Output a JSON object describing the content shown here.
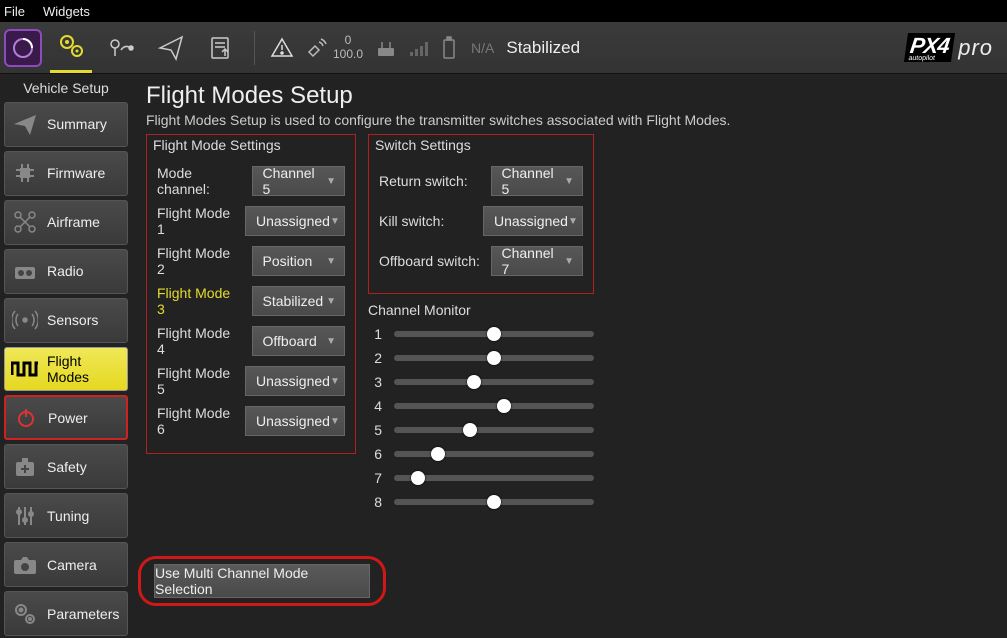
{
  "menubar": {
    "file": "File",
    "widgets": "Widgets"
  },
  "toolbar": {
    "counts_top": "0",
    "counts_bottom": "100.0",
    "na": "N/A",
    "mode": "Stabilized",
    "logo_main": "PX4",
    "logo_sub": "autopilot",
    "logo_pro": "pro"
  },
  "sidebar": {
    "title": "Vehicle Setup",
    "items": [
      {
        "label": "Summary"
      },
      {
        "label": "Firmware"
      },
      {
        "label": "Airframe"
      },
      {
        "label": "Radio"
      },
      {
        "label": "Sensors"
      },
      {
        "label": "Flight Modes"
      },
      {
        "label": "Power"
      },
      {
        "label": "Safety"
      },
      {
        "label": "Tuning"
      },
      {
        "label": "Camera"
      },
      {
        "label": "Parameters"
      }
    ]
  },
  "page": {
    "title": "Flight Modes Setup",
    "desc": "Flight Modes Setup is used to configure the transmitter switches associated with Flight Modes."
  },
  "flight_mode_settings": {
    "title": "Flight Mode Settings",
    "mode_channel_label": "Mode channel:",
    "mode_channel_value": "Channel 5",
    "rows": [
      {
        "label": "Flight Mode 1",
        "value": "Unassigned",
        "active": false
      },
      {
        "label": "Flight Mode 2",
        "value": "Position",
        "active": false
      },
      {
        "label": "Flight Mode 3",
        "value": "Stabilized",
        "active": true
      },
      {
        "label": "Flight Mode 4",
        "value": "Offboard",
        "active": false
      },
      {
        "label": "Flight Mode 5",
        "value": "Unassigned",
        "active": false
      },
      {
        "label": "Flight Mode 6",
        "value": "Unassigned",
        "active": false
      }
    ]
  },
  "switch_settings": {
    "title": "Switch Settings",
    "rows": [
      {
        "label": "Return switch:",
        "value": "Channel 5"
      },
      {
        "label": "Kill switch:",
        "value": "Unassigned"
      },
      {
        "label": "Offboard switch:",
        "value": "Channel 7"
      }
    ]
  },
  "channel_monitor": {
    "title": "Channel Monitor",
    "channels": [
      {
        "n": "1",
        "pos": 0.5
      },
      {
        "n": "2",
        "pos": 0.5
      },
      {
        "n": "3",
        "pos": 0.4
      },
      {
        "n": "4",
        "pos": 0.55
      },
      {
        "n": "5",
        "pos": 0.38
      },
      {
        "n": "6",
        "pos": 0.22
      },
      {
        "n": "7",
        "pos": 0.12
      },
      {
        "n": "8",
        "pos": 0.5
      }
    ]
  },
  "multi_button": "Use Multi Channel Mode Selection"
}
